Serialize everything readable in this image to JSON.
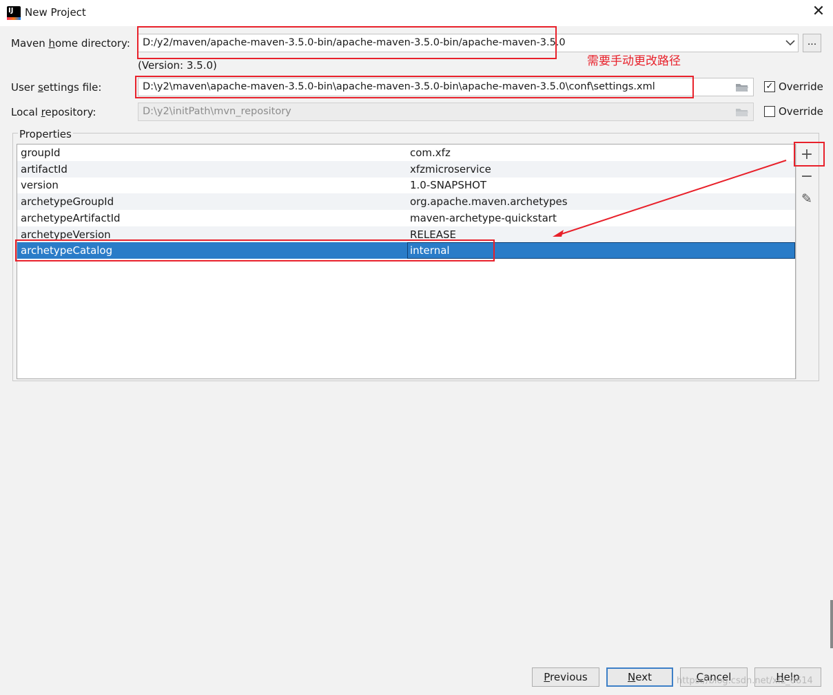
{
  "window": {
    "title": "New Project",
    "close_glyph": "✕",
    "app_icon_text": "IJ"
  },
  "maven_home": {
    "label_prefix": "Maven ",
    "label_underlined": "h",
    "label_suffix": "ome directory:",
    "value": "D:/y2/maven/apache-maven-3.5.0-bin/apache-maven-3.5.0-bin/apache-maven-3.5.0",
    "version": "(Version: 3.5.0)",
    "browse_label": "..."
  },
  "user_settings": {
    "label_prefix": "User ",
    "label_underlined": "s",
    "label_suffix": "ettings file:",
    "value": "D:\\y2\\maven\\apache-maven-3.5.0-bin\\apache-maven-3.5.0-bin\\apache-maven-3.5.0\\conf\\settings.xml",
    "override_label": "Override",
    "override_checked": "✓"
  },
  "local_repo": {
    "label_prefix": "Local ",
    "label_underlined": "r",
    "label_suffix": "epository:",
    "value": "D:\\y2\\initPath\\mvn_repository",
    "override_label": "Override"
  },
  "properties": {
    "legend": "Properties",
    "rows": [
      {
        "key": "groupId",
        "value": "com.xfz"
      },
      {
        "key": "artifactId",
        "value": "xfzmicroservice"
      },
      {
        "key": "version",
        "value": "1.0-SNAPSHOT"
      },
      {
        "key": "archetypeGroupId",
        "value": "org.apache.maven.archetypes"
      },
      {
        "key": "archetypeArtifactId",
        "value": "maven-archetype-quickstart"
      },
      {
        "key": "archetypeVersion",
        "value": "RELEASE"
      },
      {
        "key": "archetypeCatalog",
        "value": "internal"
      }
    ],
    "tools": {
      "add": "+",
      "remove": "−",
      "edit": "✎"
    }
  },
  "annotation": "需要手动更改路径",
  "buttons": {
    "previous_u": "P",
    "previous_rest": "revious",
    "next_u": "N",
    "next_rest": "ext",
    "cancel_u": "C",
    "cancel_rest": "ancel",
    "help_u": "H",
    "help_rest": "elp"
  },
  "watermark": "https://blog.csdn.net/xfz_0614",
  "colors": {
    "annotation_red": "#e8202a",
    "selection_blue": "#2a7cc8"
  }
}
